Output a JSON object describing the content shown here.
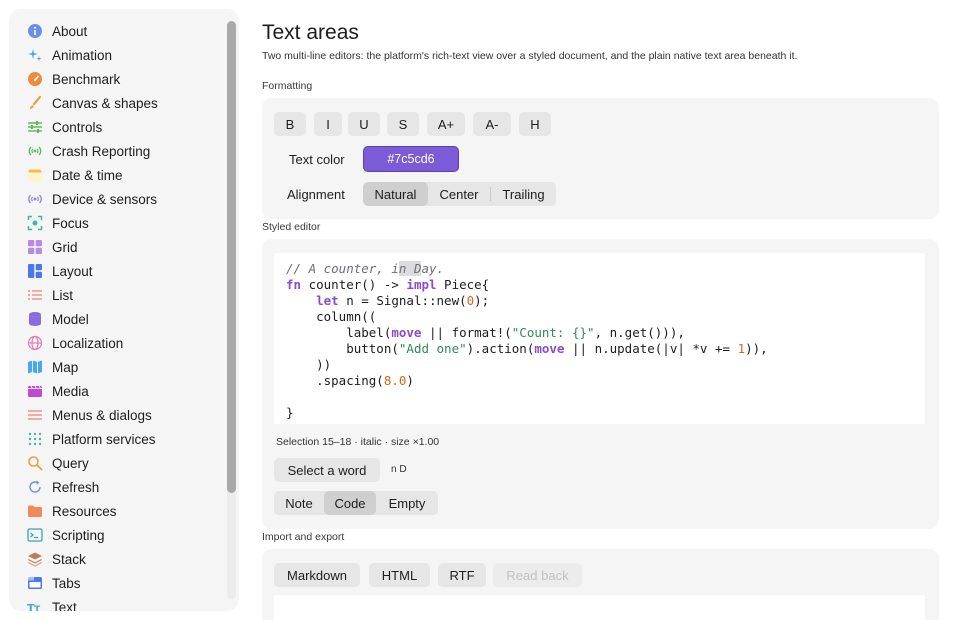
{
  "sidebar": {
    "items": [
      {
        "label": "About",
        "icon": "info-icon",
        "color": "#6b8fe8"
      },
      {
        "label": "Animation",
        "icon": "sparkles-icon",
        "color": "#4aa8e8"
      },
      {
        "label": "Benchmark",
        "icon": "speedometer-icon",
        "color": "#f08a3c"
      },
      {
        "label": "Canvas & shapes",
        "icon": "paintbrush-icon",
        "color": "#f0a040"
      },
      {
        "label": "Controls",
        "icon": "sliders-icon",
        "color": "#5cb85c"
      },
      {
        "label": "Crash Reporting",
        "icon": "antenna-icon",
        "color": "#5cb85c"
      },
      {
        "label": "Date & time",
        "icon": "calendar-icon",
        "color": "#f0c040"
      },
      {
        "label": "Device & sensors",
        "icon": "sensor-icon",
        "color": "#8a7ae8"
      },
      {
        "label": "Focus",
        "icon": "focus-icon",
        "color": "#3cb8a0"
      },
      {
        "label": "Grid",
        "icon": "grid-icon",
        "color": "#b88ae0"
      },
      {
        "label": "Layout",
        "icon": "layout-icon",
        "color": "#4a7ae8"
      },
      {
        "label": "List",
        "icon": "list-icon",
        "color": "#f08a8a"
      },
      {
        "label": "Model",
        "icon": "database-icon",
        "color": "#8a6ae0"
      },
      {
        "label": "Localization",
        "icon": "globe-icon",
        "color": "#e07ab8"
      },
      {
        "label": "Map",
        "icon": "map-icon",
        "color": "#4aa8e8"
      },
      {
        "label": "Media",
        "icon": "film-icon",
        "color": "#c04ad0"
      },
      {
        "label": "Menus & dialogs",
        "icon": "menu-icon",
        "color": "#f08a8a"
      },
      {
        "label": "Platform services",
        "icon": "dots-grid-icon",
        "color": "#3cb8a0"
      },
      {
        "label": "Query",
        "icon": "magnifier-icon",
        "color": "#f0a040"
      },
      {
        "label": "Refresh",
        "icon": "refresh-icon",
        "color": "#6b8fe8"
      },
      {
        "label": "Resources",
        "icon": "folder-icon",
        "color": "#f08a5a"
      },
      {
        "label": "Scripting",
        "icon": "terminal-icon",
        "color": "#3ca0b8"
      },
      {
        "label": "Stack",
        "icon": "stack-icon",
        "color": "#b8805a"
      },
      {
        "label": "Tabs",
        "icon": "tabs-icon",
        "color": "#4a7ae8"
      },
      {
        "label": "Text",
        "icon": "text-icon",
        "color": "#4aa8e8"
      }
    ]
  },
  "page": {
    "title": "Text areas",
    "description": "Two multi-line editors: the platform's rich-text view over a styled document, and the plain native text area beneath it."
  },
  "formatting": {
    "section_label": "Formatting",
    "buttons": [
      "B",
      "I",
      "U",
      "S",
      "A+",
      "A-",
      "H"
    ],
    "text_color_label": "Text color",
    "text_color_value": "#7c5cd6",
    "alignment_label": "Alignment",
    "alignment_options": [
      "Natural",
      "Center",
      "Trailing"
    ],
    "alignment_selected": "Natural"
  },
  "styled_editor": {
    "section_label": "Styled editor",
    "code": {
      "comment_a": "// A counter, i",
      "comment_sel": "n D",
      "comment_b": "ay.",
      "kw_fn": "fn",
      "l2_a": " counter() -> ",
      "kw_impl": "impl",
      "l2_b": " Piece{",
      "kw_let": "let",
      "l3_a": " n = Signal::new(",
      "num_0": "0",
      "l3_b": ");",
      "l4": "    column((",
      "l5_a": "        label(",
      "kw_move1": "move",
      "l5_b": " || format!(",
      "str_count": "\"Count: {}\"",
      "l5_c": ", n.get())),",
      "l6_a": "        button(",
      "str_add": "\"Add one\"",
      "l6_b": ").action(",
      "kw_move2": "move",
      "l6_c": " || n.update(|v| *v += ",
      "num_1": "1",
      "l6_d": ")),",
      "l7": "    ))",
      "l8_a": "    .spacing(",
      "num_8": "8.0",
      "l8_b": ")",
      "l10": "}"
    },
    "selection_info": "Selection 15–18 · italic · size ×1.00",
    "select_word_button": "Select a word",
    "selected_word": "n D",
    "content_options": [
      "Note",
      "Code",
      "Empty"
    ],
    "content_selected": "Code"
  },
  "import_export": {
    "section_label": "Import and export",
    "buttons": [
      "Markdown",
      "HTML",
      "RTF"
    ],
    "read_back_button": "Read back"
  }
}
